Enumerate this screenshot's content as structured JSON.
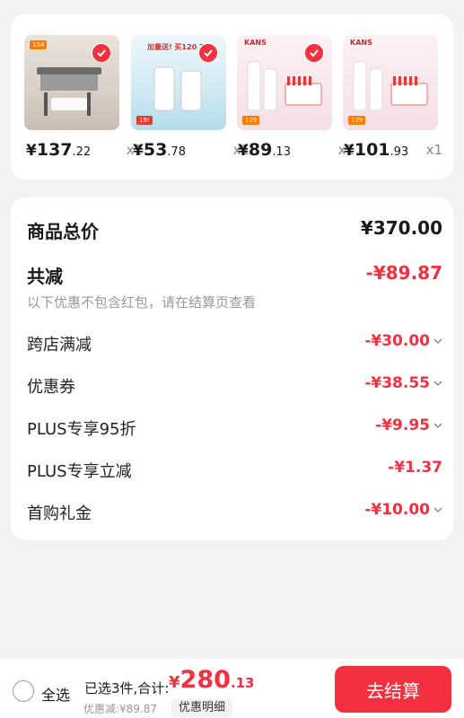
{
  "products": [
    {
      "id": "p1",
      "price_int": "137",
      "price_dec": ".22",
      "qty": "x1",
      "brand": "",
      "banner": "",
      "badge": "154",
      "strip": ""
    },
    {
      "id": "p2",
      "price_int": "53",
      "price_dec": ".78",
      "qty": "x1",
      "brand": "",
      "banner": "加量送! 买120 2",
      "badge": "19!",
      "strip": ""
    },
    {
      "id": "p3",
      "price_int": "89",
      "price_dec": ".13",
      "qty": "x1",
      "brand": "KANS",
      "banner": "",
      "badge": "129",
      "strip": ""
    },
    {
      "id": "p4",
      "price_int": "101",
      "price_dec": ".93",
      "qty": "x1",
      "brand": "KANS",
      "banner": "",
      "badge": "129",
      "strip": ""
    }
  ],
  "currency": "¥",
  "summary": {
    "total_label": "商品总价",
    "total_value": "¥370.00",
    "reduce_label": "共减",
    "reduce_value": "-¥89.87",
    "hint": "以下优惠不包含红包，请在结算页查看",
    "items": [
      {
        "label": "跨店满减",
        "value": "-¥30.00"
      },
      {
        "label": "优惠券",
        "value": "-¥38.55"
      },
      {
        "label": "PLUS专享95折",
        "value": "-¥9.95"
      },
      {
        "label": "PLUS专享立减",
        "value": "-¥1.37"
      },
      {
        "label": "首购礼金",
        "value": "-¥10.00"
      }
    ]
  },
  "bottom": {
    "select_all": "全选",
    "selected_text": "已选3件,合计:",
    "total_yen": "¥",
    "total_int": "280",
    "total_dec": ".13",
    "saved": "优惠减:¥89.87",
    "detail_button": "优惠明细",
    "checkout_button": "去结算"
  },
  "colors": {
    "accent": "#f2303f",
    "background": "#f2f2f2"
  }
}
